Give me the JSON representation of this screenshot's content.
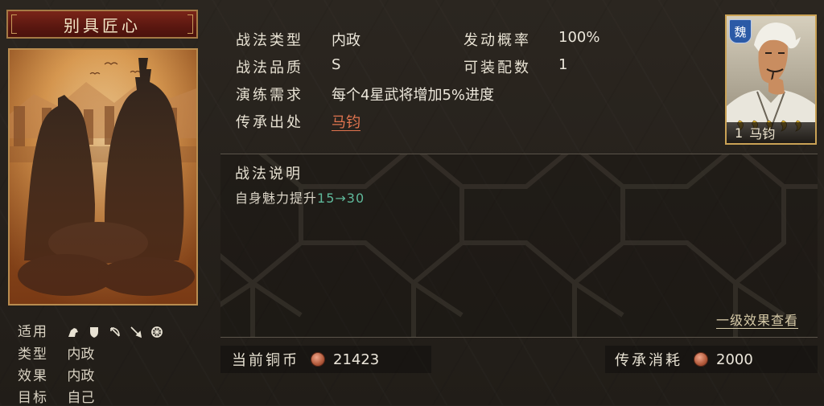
{
  "skill": {
    "name": "别具匠心",
    "card_fields": [
      {
        "key": "适用",
        "value": ""
      },
      {
        "key": "类型",
        "value": "内政"
      },
      {
        "key": "效果",
        "value": "内政"
      },
      {
        "key": "目标",
        "value": "自己"
      }
    ],
    "applicable_icons": [
      "cavalry-icon",
      "shield-icon",
      "bow-icon",
      "spear-icon",
      "wheel-icon"
    ]
  },
  "info": {
    "type_label": "战法类型",
    "type_value": "内政",
    "rate_label": "发动概率",
    "rate_value": "100%",
    "quality_label": "战法品质",
    "quality_value": "S",
    "equip_label": "可装配数",
    "equip_value": "1",
    "train_label": "演练需求",
    "train_value": "每个4星武将增加5%进度",
    "source_label": "传承出处",
    "source_value": "马钧"
  },
  "description": {
    "title": "战法说明",
    "text_prefix": "自身魅力提升",
    "from_value": "15",
    "arrow": "→",
    "to_value": "30",
    "detail_link": "一级效果查看"
  },
  "resources": {
    "coins_label": "当前铜币",
    "coins_value": "21423",
    "cost_label": "传承消耗",
    "cost_value": "2000"
  },
  "general": {
    "faction": "魏",
    "stars": 5,
    "level": "1",
    "name": "马钧"
  },
  "colors": {
    "accent_red": "#e0744f",
    "value_green": "#5fb89a",
    "frame_gold": "#caa255",
    "faction_blue": "#2b5aa6"
  }
}
